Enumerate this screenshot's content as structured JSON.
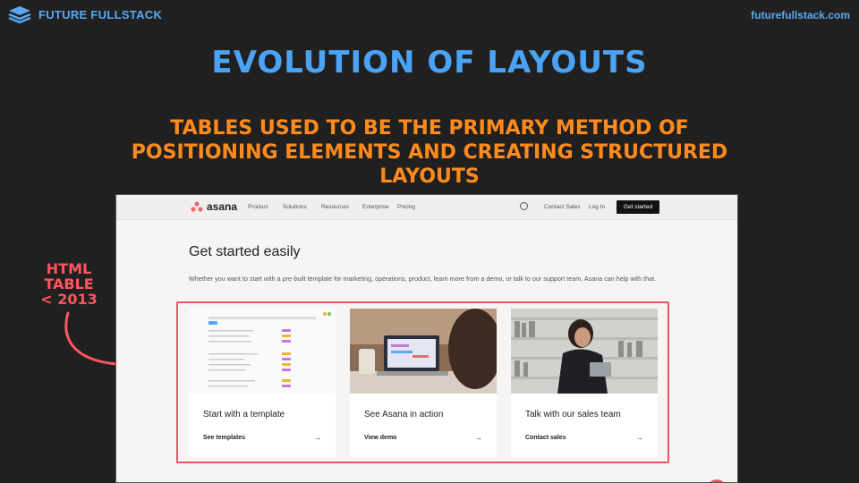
{
  "brand": {
    "name": "FUTURE FULLSTACK",
    "icon": "stack-layers-icon",
    "color": "#5aa9f2"
  },
  "site_url": "futurefullstack.com",
  "slide": {
    "title": "EVOLUTION OF LAYOUTS",
    "subtitle": "TABLES USED TO BE THE PRIMARY METHOD OF POSITIONING ELEMENTS AND CREATING STRUCTURED LAYOUTS",
    "side_note": [
      "HTML",
      "TABLE",
      "< 2013"
    ],
    "colors": {
      "title": "#4aa3f5",
      "subtitle": "#ff8a1e",
      "note": "#ff5660"
    }
  },
  "screenshot": {
    "nav": {
      "logo": "asana",
      "items": [
        "Product",
        "Solutions",
        "Resources",
        "Enterprise",
        "Pricing"
      ],
      "contact": "Contact Sales",
      "login": "Log In",
      "cta": "Get started"
    },
    "hero": {
      "heading": "Get started easily",
      "text": "Whether you want to start with a pre-built template for marketing, operations, product, learn more from a demo, or talk to our support team, Asana can help with that."
    },
    "cards": [
      {
        "title": "Start with a template",
        "link": "See templates",
        "arrow": "→"
      },
      {
        "title": "See Asana in action",
        "link": "View demo",
        "arrow": "→"
      },
      {
        "title": "Talk with our sales team",
        "link": "Contact sales",
        "arrow": "→"
      }
    ],
    "highlight_color": "#f05363"
  }
}
